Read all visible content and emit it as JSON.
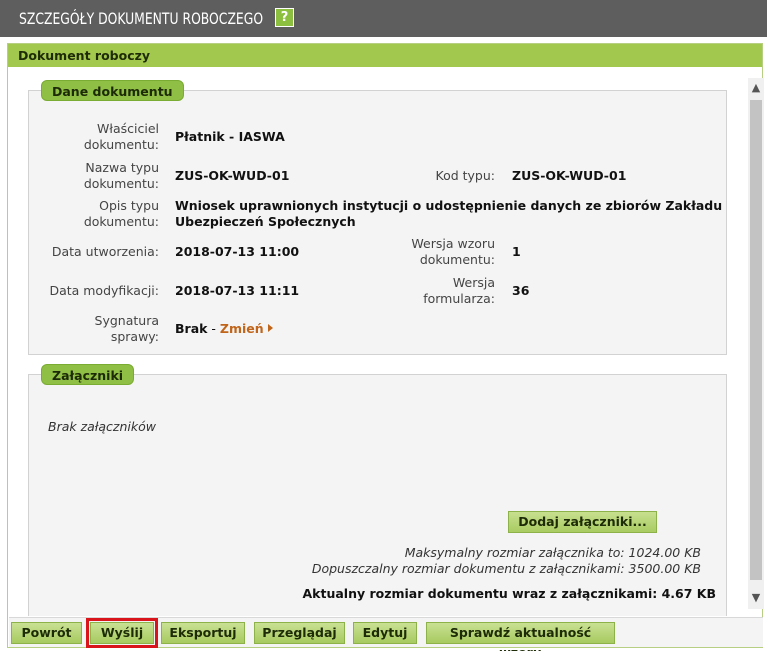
{
  "window": {
    "title": "SZCZEGÓŁY DOKUMENTU ROBOCZEGO",
    "help_icon": "?"
  },
  "panel": {
    "title": "Dokument roboczy"
  },
  "document_data": {
    "section_title": "Dane dokumentu",
    "owner_label_1": "Właściciel",
    "owner_label_2": "dokumentu:",
    "owner_value": "Płatnik - IASWA",
    "type_name_label_1": "Nazwa typu",
    "type_name_label_2": "dokumentu:",
    "type_name_value": "ZUS-OK-WUD-01",
    "type_code_label": "Kod typu:",
    "type_code_value": "ZUS-OK-WUD-01",
    "type_desc_label_1": "Opis typu",
    "type_desc_label_2": "dokumentu:",
    "type_desc_value_1": "Wniosek uprawnionych instytucji o udostępnienie danych ze zbiorów Zakładu",
    "type_desc_value_2": "Ubezpieczeń Społecznych",
    "created_label": "Data utworzenia:",
    "created_value": "2018-07-13 11:00",
    "template_version_label_1": "Wersja wzoru",
    "template_version_label_2": "dokumentu:",
    "template_version_value": "1",
    "modified_label": "Data modyfikacji:",
    "modified_value": "2018-07-13 11:11",
    "form_version_label_1": "Wersja",
    "form_version_label_2": "formularza:",
    "form_version_value": "36",
    "case_label_1": "Sygnatura",
    "case_label_2": "sprawy:",
    "case_value": "Brak",
    "case_separator": " - ",
    "case_change_link": "Zmień"
  },
  "attachments": {
    "section_title": "Załączniki",
    "empty_text": "Brak załączników",
    "add_button": "Dodaj załączniki...",
    "max_size_text": "Maksymalny rozmiar załącznika to: 1024.00 KB",
    "allowed_size_text": "Dopuszczalny rozmiar dokumentu z załącznikami: 3500.00 KB",
    "current_size_text": "Aktualny rozmiar dokumentu wraz z załącznikami: 4.67 KB"
  },
  "toolbar": {
    "back": "Powrót",
    "send": "Wyślij",
    "export": "Eksportuj",
    "browse": "Przeglądaj",
    "edit": "Edytuj",
    "check_template": "Sprawdź aktualność wzoru"
  },
  "colors": {
    "accent_green": "#a3c84e",
    "title_bar": "#5e5e5e",
    "highlight_red": "#d9141b",
    "link_orange": "#c0651a"
  },
  "icons": {
    "help": "help-icon",
    "change_arrow": "arrow-right-icon",
    "scroll_up": "chevron-up-icon",
    "scroll_down": "chevron-down-icon"
  }
}
